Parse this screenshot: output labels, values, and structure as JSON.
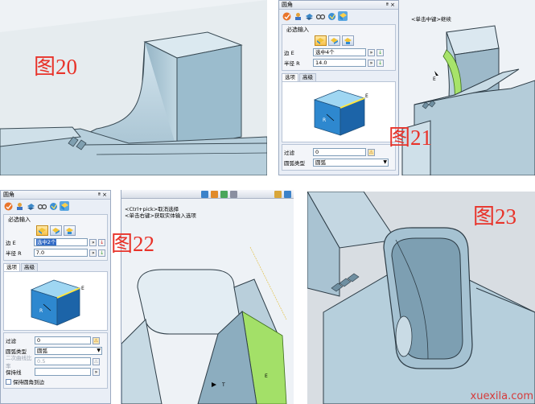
{
  "figure_labels": {
    "fig20": "图20",
    "fig21": "图21",
    "fig22": "图22",
    "fig23": "图23"
  },
  "panel21": {
    "title": "圆角",
    "pin": "ª ×",
    "group_title": "必选输入",
    "edge_label": "边 E",
    "edge_value": "选中4个",
    "radius_label": "半径 R",
    "radius_value": "14.0",
    "tabs": [
      "选项",
      "高级"
    ],
    "preview_e": "E",
    "preview_r": "R",
    "filter_label": "过滤",
    "filter_value": "0",
    "type_label": "圆弧类型",
    "type_value": "圆弧",
    "viewport_hint": "<单击中键>继续"
  },
  "panel22": {
    "title": "圆角",
    "pin": "ª ×",
    "group_title": "必选输入",
    "edge_label": "边 E",
    "edge_value": "选中2个",
    "radius_label": "半径 R",
    "radius_value": "7.0",
    "tabs": [
      "选项",
      "高级"
    ],
    "preview_e": "E",
    "preview_r": "R",
    "filter_label": "过滤",
    "filter_value": "0",
    "type_label": "圆弧类型",
    "type_value": "圆弧",
    "ratio_label": "二次曲线比率",
    "ratio_value": "0.5",
    "keep_line_label": "保持线",
    "keep_fillet_label": "保持圆角到边",
    "viewport_hint_1": "<Ctrl+pick>取消选择",
    "viewport_hint_2": "<单击右键>获取实体输入选项",
    "viewport_e": "E",
    "viewport_t": "T"
  },
  "watermark": "xuexila.com",
  "colors": {
    "label_red": "#e8332a",
    "part_blue": "#a9c6d6",
    "fillet_green": "#9be05a",
    "selection_blue": "#316ac5"
  }
}
